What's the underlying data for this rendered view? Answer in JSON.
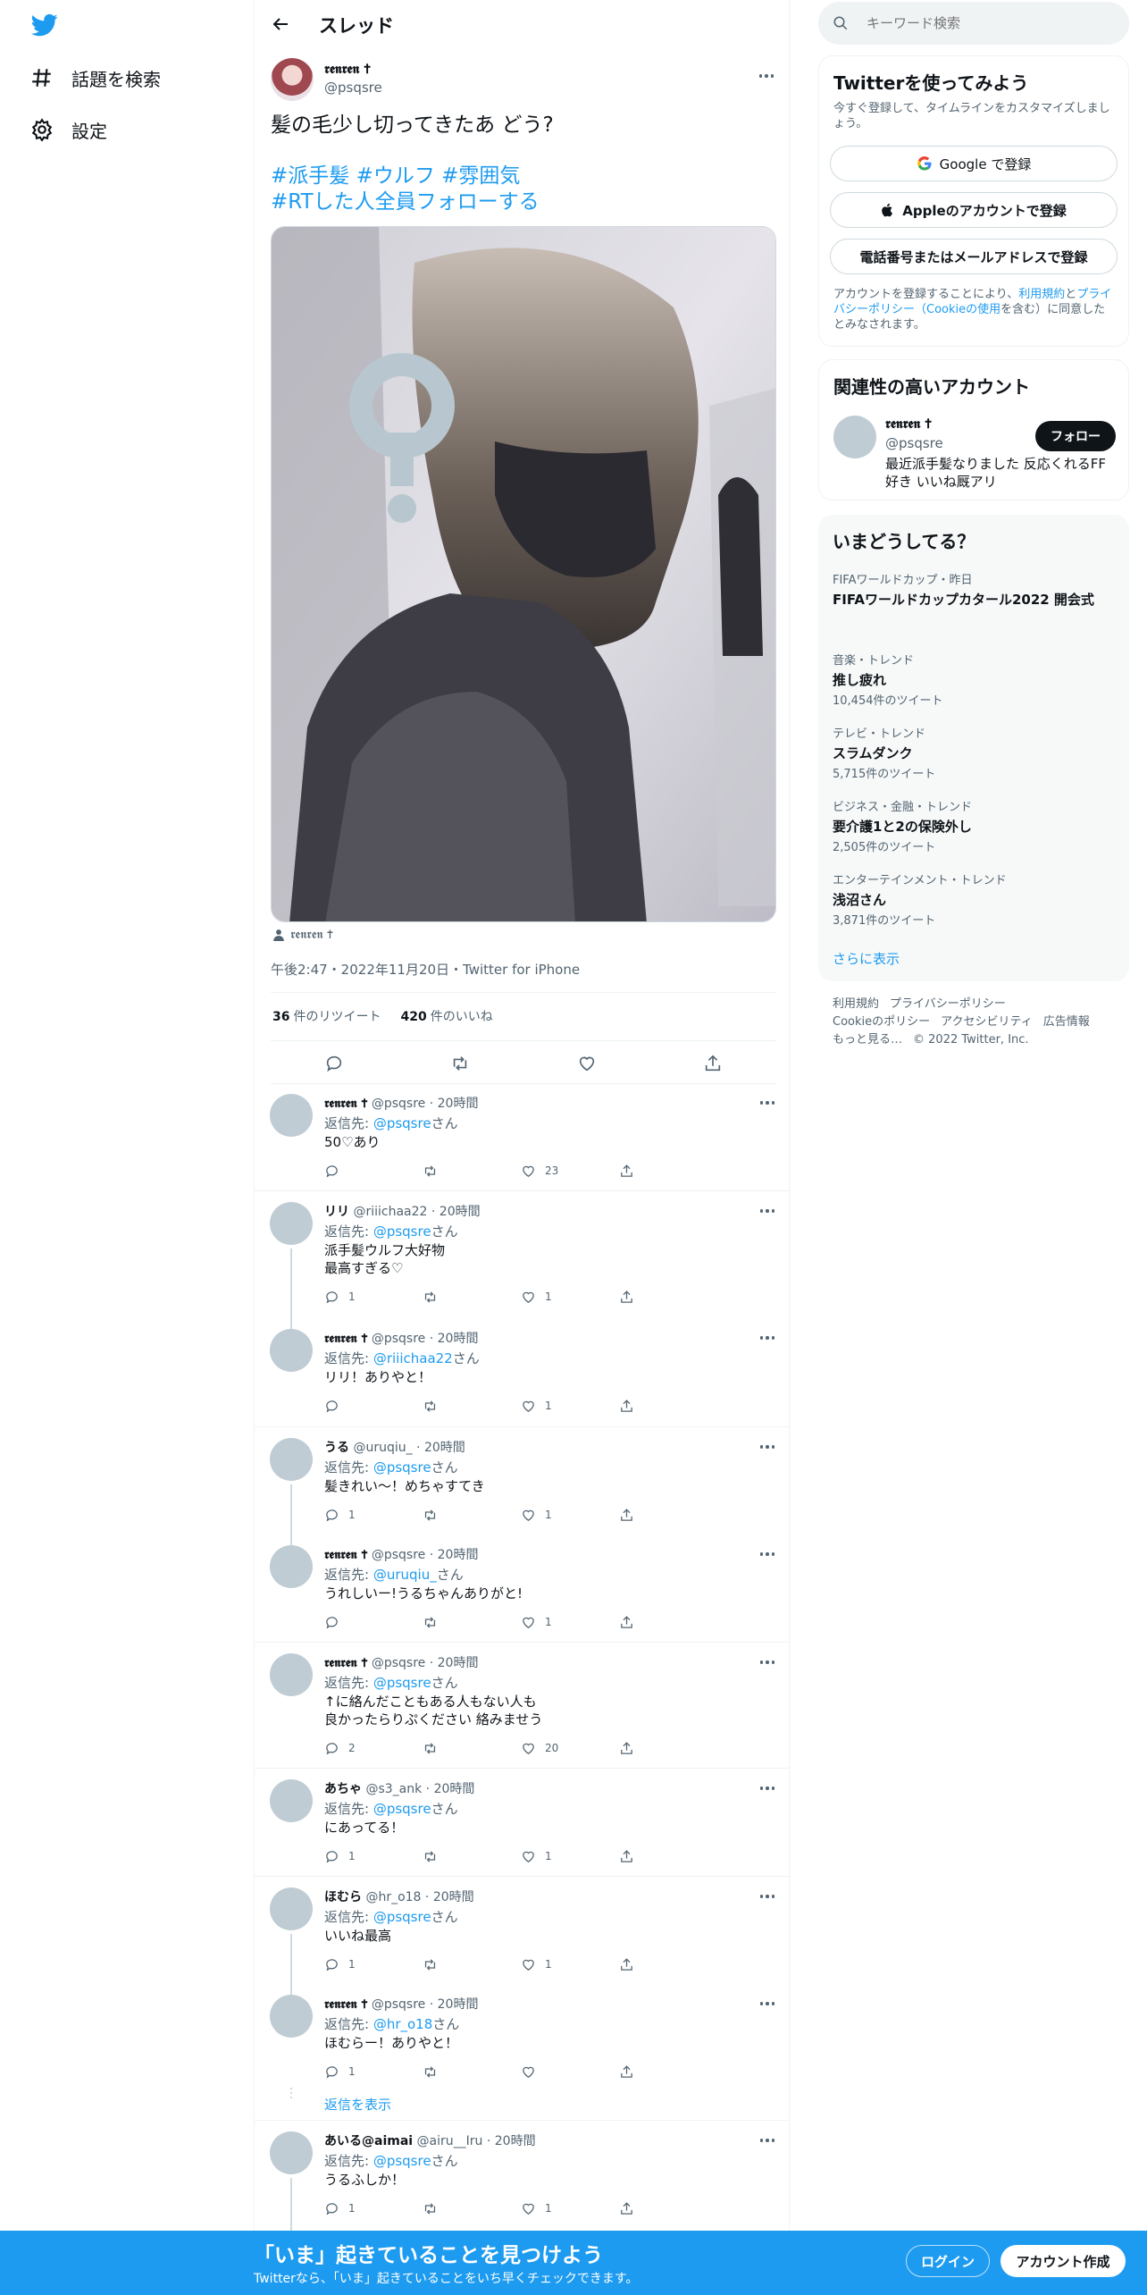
{
  "sidebar": {
    "logo": "twitter-bird-icon",
    "items": [
      {
        "label": "話題を検索",
        "icon": "hashtag-icon"
      },
      {
        "label": "設定",
        "icon": "gear-icon"
      }
    ]
  },
  "header": {
    "title": "スレッド",
    "back_icon": "arrow-left-icon"
  },
  "tweet": {
    "author_name": "𝖗𝖊𝖓𝖗𝖊𝖓 ✝",
    "handle": "@psqsre",
    "text": "髪の毛少し切ってきたあ どう?",
    "hashtags_line1": "#派手髪 #ウルフ #雰囲気",
    "hashtags_line2": "#RTした人全員フォローする",
    "tagged_user": "𝖗𝖊𝖓𝖗𝖊𝖓 ✝",
    "meta": "午後2:47・2022年11月20日・Twitter for iPhone",
    "retweets_count": "36",
    "retweets_label": "件のリツイート",
    "likes_count": "420",
    "likes_label": "件のいいね"
  },
  "replies": [
    {
      "name": "𝖗𝖊𝖓𝖗𝖊𝖓 ✝",
      "gothic": true,
      "handle": "@psqsre",
      "time": "20時間",
      "reply_prefix": "返信先: ",
      "reply_to": "@psqsre",
      "reply_suffix": "さん",
      "text": "50♡あり",
      "replies": "",
      "retweets": "",
      "likes": "23",
      "chained_below": false
    },
    {
      "name": "リリ",
      "gothic": false,
      "handle": "@riiichaa22",
      "time": "20時間",
      "reply_prefix": "返信先: ",
      "reply_to": "@psqsre",
      "reply_suffix": "さん",
      "text": "派手髪ウルフ大好物\n最高すぎる♡",
      "replies": "1",
      "retweets": "",
      "likes": "1",
      "chained_below": true
    },
    {
      "name": "𝖗𝖊𝖓𝖗𝖊𝖓 ✝",
      "gothic": true,
      "handle": "@psqsre",
      "time": "20時間",
      "reply_prefix": "返信先: ",
      "reply_to": "@riiichaa22",
      "reply_suffix": "さん",
      "text": "リリ！ありやと！",
      "replies": "",
      "retweets": "",
      "likes": "1",
      "chained_below": false
    },
    {
      "name": "うる",
      "gothic": false,
      "handle": "@uruqiu_",
      "time": "20時間",
      "reply_prefix": "返信先: ",
      "reply_to": "@psqsre",
      "reply_suffix": "さん",
      "text": "髪きれい〜！めちゃすてき",
      "replies": "1",
      "retweets": "",
      "likes": "1",
      "chained_below": true
    },
    {
      "name": "𝖗𝖊𝖓𝖗𝖊𝖓 ✝",
      "gothic": true,
      "handle": "@psqsre",
      "time": "20時間",
      "reply_prefix": "返信先: ",
      "reply_to": "@uruqiu_",
      "reply_suffix": "さん",
      "text": "うれしいー!うるちゃんありがと!",
      "replies": "",
      "retweets": "",
      "likes": "1",
      "chained_below": false
    },
    {
      "name": "𝖗𝖊𝖓𝖗𝖊𝖓 ✝",
      "gothic": true,
      "handle": "@psqsre",
      "time": "20時間",
      "reply_prefix": "返信先: ",
      "reply_to": "@psqsre",
      "reply_suffix": "さん",
      "text": "↑に絡んだこともある人もない人も\n良かったらりぷください 絡みませう",
      "replies": "2",
      "retweets": "",
      "likes": "20",
      "chained_below": false
    },
    {
      "name": "あちゃ",
      "gothic": false,
      "handle": "@s3_ank",
      "time": "20時間",
      "reply_prefix": "返信先: ",
      "reply_to": "@psqsre",
      "reply_suffix": "さん",
      "text": "にあってる！",
      "replies": "1",
      "retweets": "",
      "likes": "1",
      "chained_below": false
    },
    {
      "name": "ほむら",
      "gothic": false,
      "handle": "@hr_o18",
      "time": "20時間",
      "reply_prefix": "返信先: ",
      "reply_to": "@psqsre",
      "reply_suffix": "さん",
      "text": "いいね最高",
      "replies": "1",
      "retweets": "",
      "likes": "1",
      "chained_below": true
    },
    {
      "name": "𝖗𝖊𝖓𝖗𝖊𝖓 ✝",
      "gothic": true,
      "handle": "@psqsre",
      "time": "20時間",
      "reply_prefix": "返信先: ",
      "reply_to": "@hr_o18",
      "reply_suffix": "さん",
      "text": "ほむらー！ありやと！",
      "replies": "1",
      "retweets": "",
      "likes": "",
      "chained_below": false
    },
    {
      "name": "あいる@aimai",
      "gothic": false,
      "handle": "@airu__Iru",
      "time": "20時間",
      "reply_prefix": "返信先: ",
      "reply_to": "@psqsre",
      "reply_suffix": "さん",
      "text": "うるふしか！",
      "replies": "1",
      "retweets": "",
      "likes": "1",
      "chained_below": true
    }
  ],
  "show_replies": "返信を表示",
  "search": {
    "placeholder": "キーワード検索"
  },
  "signup_card": {
    "title": "Twitterを使ってみよう",
    "subtitle": "今すぐ登録して、タイムラインをカスタマイズしましょう。",
    "google": "Google で登録",
    "apple": "Appleのアカウントで登録",
    "email": "電話番号またはメールアドレスで登録",
    "legal_1": "アカウントを登録することにより、",
    "legal_terms": "利用規約",
    "legal_and": "と",
    "legal_privacy": "プライバシーポリシー（Cookieの使用",
    "legal_end": "を含む）に同意したとみなされます。"
  },
  "related": {
    "title": "関連性の高いアカウント",
    "name": "𝖗𝖊𝖓𝖗𝖊𝖓 ✝",
    "handle": "@psqsre",
    "bio": "最近派手髪なりました 反応くれるFF好き いいね厩アリ",
    "follow": "フォロー"
  },
  "trends": {
    "title": "いまどうしてる？",
    "items": [
      {
        "category": "FIFAワールドカップ・昨日",
        "title": "FIFAワールドカップカタール2022 開会式",
        "count": ""
      },
      {
        "category": "音楽・トレンド",
        "title": "推し疲れ",
        "count": "10,454件のツイート"
      },
      {
        "category": "テレビ・トレンド",
        "title": "スラムダンク",
        "count": "5,715件のツイート"
      },
      {
        "category": "ビジネス・金融・トレンド",
        "title": "要介護1と2の保険外し",
        "count": "2,505件のツイート"
      },
      {
        "category": "エンターテインメント・トレンド",
        "title": "浅沼さん",
        "count": "3,871件のツイート"
      }
    ],
    "more": "さらに表示"
  },
  "footer": {
    "terms": "利用規約",
    "privacy": "プライバシーポリシー",
    "cookie": "Cookieのポリシー",
    "accessibility": "アクセシビリティ",
    "ads": "広告情報",
    "more": "もっと見る…",
    "copyright": "© 2022 Twitter, Inc."
  },
  "banner": {
    "headline": "「いま」起きていることを見つけよう",
    "sub": "Twitterなら、「いま」起きていることをいち早くチェックできます。",
    "login": "ログイン",
    "signup": "アカウント作成"
  },
  "colors": {
    "accent": "#1d9bf0",
    "text": "#0f1419",
    "muted": "#536471"
  }
}
